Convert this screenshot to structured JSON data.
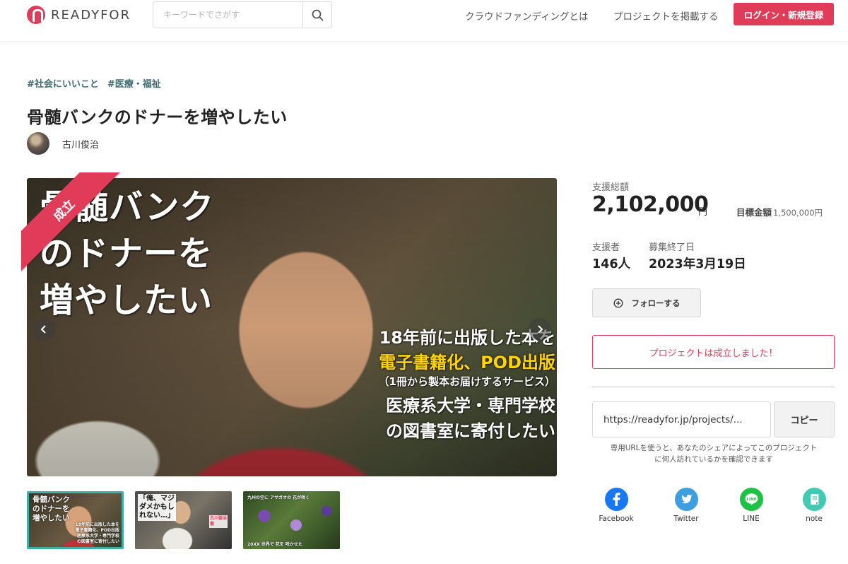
{
  "header": {
    "logo_text": "READYFOR",
    "search_placeholder": "キーワードでさがす",
    "nav": [
      "クラウドファンディングとは",
      "プロジェクトを掲載する"
    ],
    "login_label": "ログイン・新規登録",
    "brand_color": "#e03b59"
  },
  "project": {
    "tags": [
      "#社会にいいこと",
      "#医療・福祉"
    ],
    "title": "骨髄バンクのドナーを増やしたい",
    "author": "古川俊治"
  },
  "hero": {
    "ribbon": "成立",
    "title_lines": [
      "骨髄バンク",
      "のドナーを",
      "増やしたい"
    ],
    "sub_lines": [
      "18年前に出版した本を",
      "電子書籍化、POD出版",
      "（1冊から製本お届けするサービス）",
      "医療系大学・専門学校",
      "の図書室に寄付したい"
    ]
  },
  "thumbnails": [
    {
      "caption_top": "骨髄バンク\nのドナーを\n増やしたい",
      "caption_bottom": "18年前に出版した本を\n電子書籍化、POD出版\n医療系大学・専門学校\nの図書室に寄付したい"
    },
    {
      "caption_top": "「俺、マジ\nダメかもし\nれない…」",
      "caption_bottom": "古川俊治\n著"
    },
    {
      "caption_top": "九州の空に アサガオの 花が咲く",
      "caption_bottom": "20XX 世界で 花を 咲かせた"
    }
  ],
  "stats": {
    "total_label": "支援総額",
    "total_amount": "2,102,000",
    "total_unit": "円",
    "goal_label": "目標金額",
    "goal_amount": "1,500,000円",
    "supporters_label": "支援者",
    "supporters_value": "146人",
    "end_label": "募集終了日",
    "end_value": "2023年3月19日"
  },
  "actions": {
    "follow_label": "フォローする",
    "success_message": "プロジェクトは成立しました！",
    "url_value": "https://readyfor.jp/projects/...",
    "copy_label": "コピー",
    "url_note": "専用URLを使うと、あなたのシェアによってこのプロジェクトに何人訪れているかを確認できます"
  },
  "share": [
    {
      "label": "Facebook",
      "color": "#1877f2",
      "icon": "facebook-icon"
    },
    {
      "label": "Twitter",
      "color": "#3f9ee0",
      "icon": "twitter-icon"
    },
    {
      "label": "LINE",
      "color": "#1dc143",
      "icon": "line-icon"
    },
    {
      "label": "note",
      "color": "#41c9b4",
      "icon": "note-icon"
    }
  ]
}
